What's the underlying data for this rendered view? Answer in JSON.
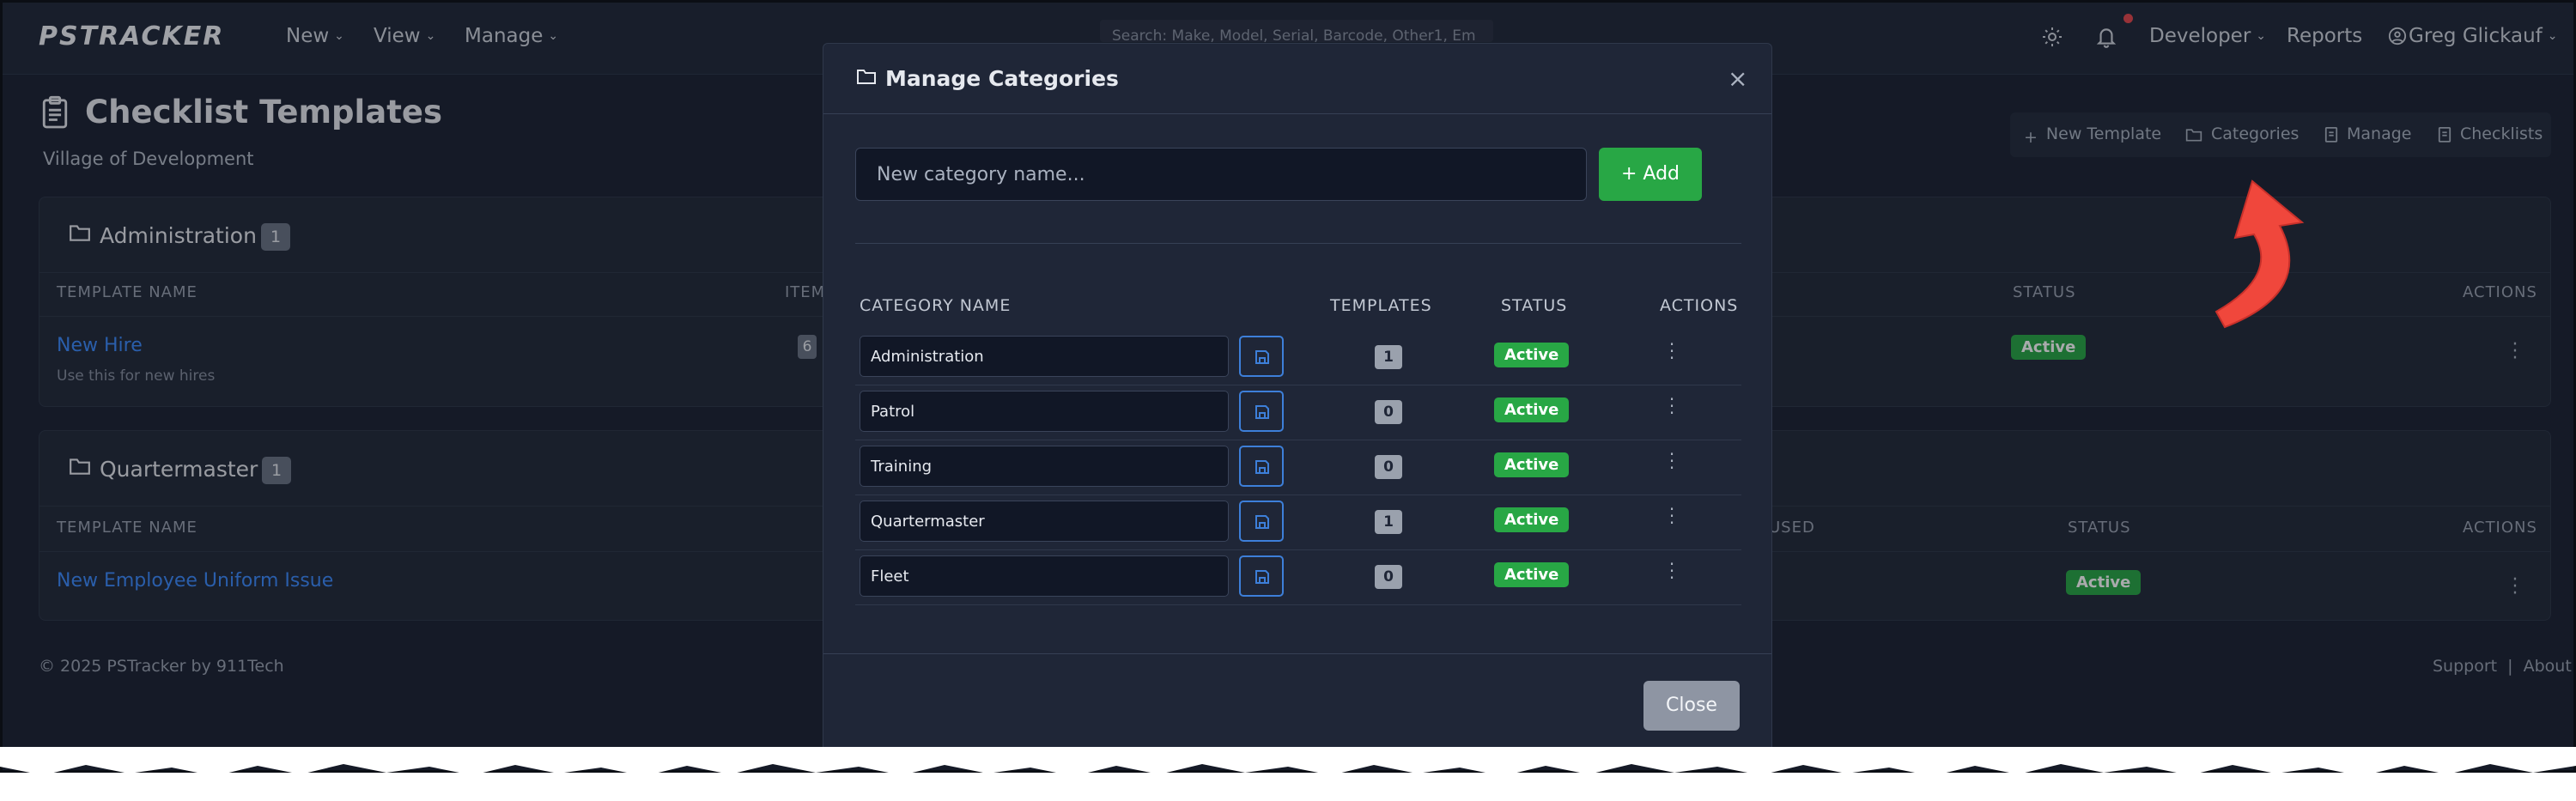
{
  "navbar": {
    "logo": "PSTRACKER",
    "menus": [
      "New",
      "View",
      "Manage"
    ],
    "search_placeholder": "Search: Make, Model, Serial, Barcode, Other1, Em",
    "user_menu": "Developer",
    "reports": "Reports",
    "user_name": "Greg Glickauf"
  },
  "page": {
    "title": "Checklist Templates",
    "subtitle": "Village of Development",
    "toolbar": [
      "New Template",
      "Categories",
      "Manage",
      "Checklists"
    ]
  },
  "cards": [
    {
      "title": "Administration",
      "count": "1",
      "headers": {
        "name": "TEMPLATE NAME",
        "items": "ITEM",
        "status": "STATUS",
        "actions": "ACTIONS"
      },
      "row": {
        "name": "New Hire",
        "desc": "Use this for new hires",
        "items": "6",
        "status": "Active"
      }
    },
    {
      "title": "Quartermaster",
      "count": "1",
      "headers": {
        "name": "TEMPLATE NAME",
        "used": "USED",
        "status": "STATUS",
        "actions": "ACTIONS"
      },
      "row": {
        "name": "New Employee Uniform Issue",
        "status": "Active"
      }
    }
  ],
  "footer": {
    "copyright": "© 2025  PSTracker by 911Tech",
    "support": "Support",
    "separator": "|",
    "about": "About"
  },
  "modal": {
    "title": "Manage Categories",
    "close_glyph": "×",
    "input_placeholder": "New category name...",
    "add_label": "+ Add",
    "headers": {
      "name": "CATEGORY NAME",
      "templates": "TEMPLATES",
      "status": "STATUS",
      "actions": "ACTIONS"
    },
    "rows": [
      {
        "name": "Administration",
        "templates": "1",
        "status": "Active"
      },
      {
        "name": "Patrol",
        "templates": "0",
        "status": "Active"
      },
      {
        "name": "Training",
        "templates": "0",
        "status": "Active"
      },
      {
        "name": "Quartermaster",
        "templates": "1",
        "status": "Active"
      },
      {
        "name": "Fleet",
        "templates": "0",
        "status": "Active"
      }
    ],
    "close_label": "Close"
  },
  "colors": {
    "background": "#1c2333",
    "accent_link": "#3d8bfd",
    "success": "#28a745",
    "annotation_arrow": "#f0473c"
  }
}
